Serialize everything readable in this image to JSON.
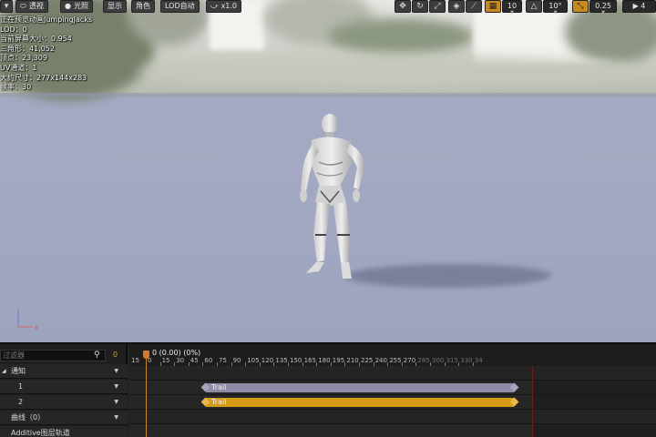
{
  "toolbar": {
    "perspective_label": "透视",
    "lit_label": "光照",
    "show_label": "显示",
    "character_label": "角色",
    "lod_label": "LOD自动",
    "speed_label": "x1.0",
    "grid_snap_value": "10",
    "rotate_snap_value": "10°",
    "scale_snap_value": "0.25",
    "camera_speed_value": "4"
  },
  "stats": {
    "preview": "正在预览动画JumpingJacks",
    "lod": "LOD：0",
    "screen_size": "当前屏幕大小：0.954",
    "triangles": "三角形：41,052",
    "vertices": "顶点：23,309",
    "uv_channels": "UV通道：1",
    "approx_size": "大约尺寸：277x144x283",
    "framerate": "帧率：30"
  },
  "timeline": {
    "filter_placeholder": "过滤器",
    "filter_count": "0",
    "rows": {
      "notifies": "通知",
      "track1": "1",
      "track2": "2",
      "curves": "曲线（0）",
      "additive": "Additive图层轨道"
    },
    "scrub_text": "0 (0.00) (0%)",
    "ruler_first": "15",
    "ruler_labels": [
      "0",
      "15",
      "30",
      "45",
      "60",
      "75",
      "90",
      "105",
      "120",
      "135",
      "150",
      "165",
      "180",
      "195",
      "210",
      "225",
      "240",
      "255",
      "270",
      "285",
      "300",
      "315",
      "330",
      "34"
    ],
    "notify_1": "Trail",
    "notify_2": "Trail"
  },
  "colors": {
    "accent_orange": "#d49a14",
    "playhead": "#d27a28",
    "notify_1": "#8d8ba5"
  }
}
